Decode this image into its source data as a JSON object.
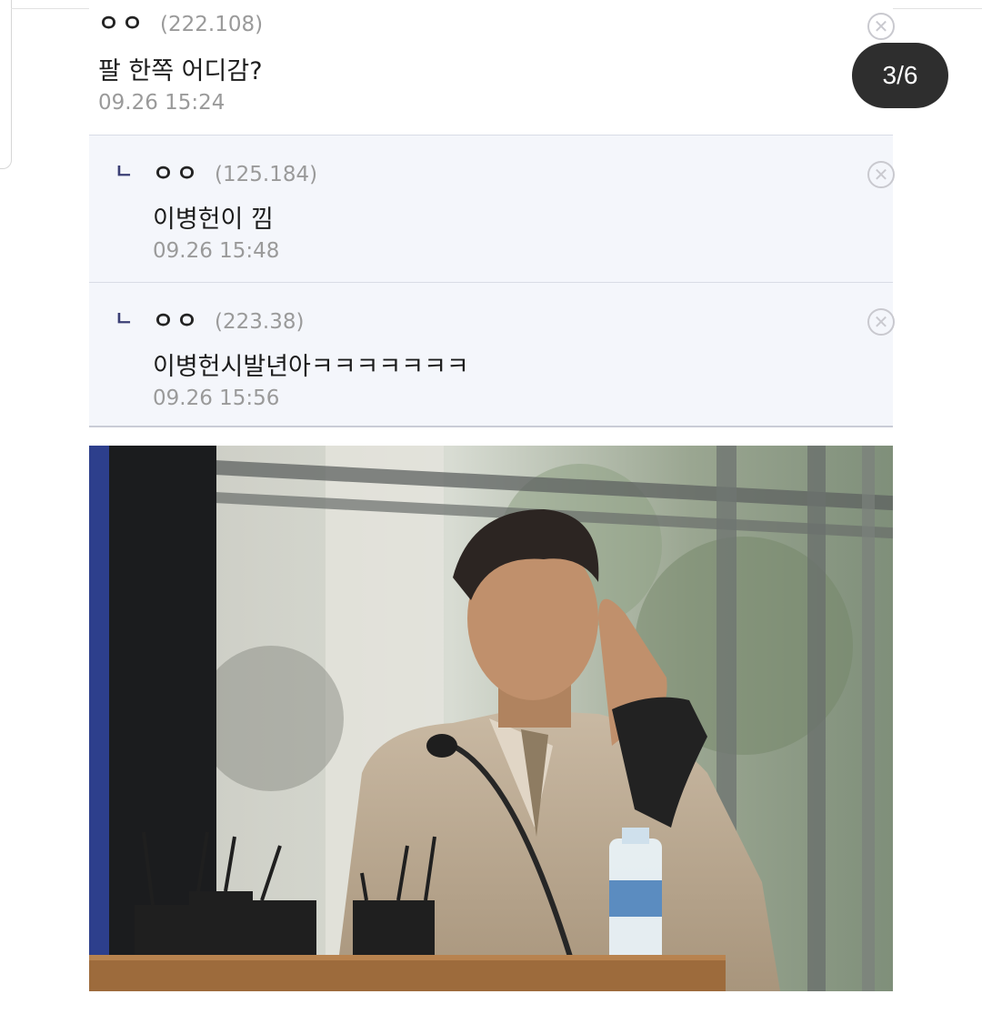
{
  "counter": "3/6",
  "comments": [
    {
      "nick": "ㅇㅇ",
      "ip": "(222.108)",
      "text": "팔 한쪽 어디감?",
      "date": "09.26 15:24"
    },
    {
      "nick": "ㅇㅇ",
      "ip": "(125.184)",
      "text": "이병헌이 낌",
      "date": "09.26 15:48",
      "reply": true
    },
    {
      "nick": "ㅇㅇ",
      "ip": "(223.38)",
      "text": "이병헌시발년아ㅋㅋㅋㅋㅋㅋㅋ",
      "date": "09.26 15:56",
      "reply": true
    }
  ],
  "reply_marker": "ㄴ",
  "delete_icon": "close-circle-icon",
  "photo": {
    "description": "man in beige suit at podium with microphones and water bottle"
  }
}
